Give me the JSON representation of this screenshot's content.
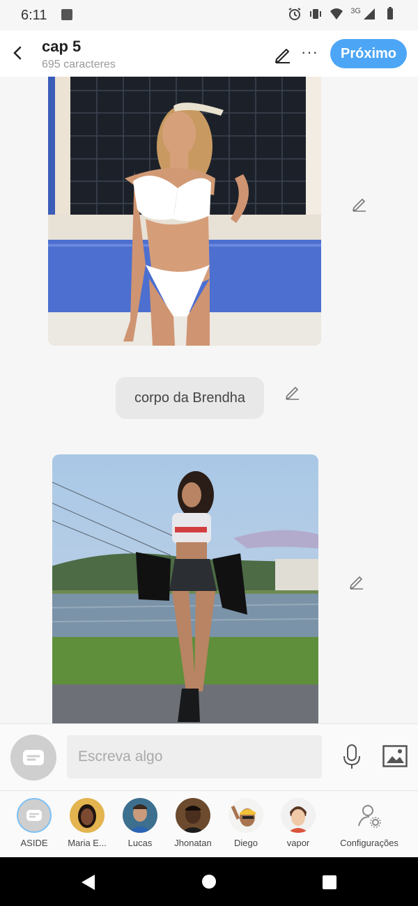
{
  "status_bar": {
    "time": "6:11",
    "network": "3G",
    "icons": [
      "image-icon",
      "alarm-icon",
      "vibrate-icon",
      "wifi-icon",
      "signal-icon",
      "battery-icon"
    ]
  },
  "header": {
    "title": "cap 5",
    "subtitle": "695 caracteres",
    "next_label": "Próximo",
    "more_label": "···",
    "accent": "#4da6f5"
  },
  "messages": [
    {
      "type": "image",
      "description_icon": "photo-1"
    },
    {
      "type": "text",
      "text": "corpo da Brendha"
    },
    {
      "type": "image",
      "description_icon": "photo-2"
    }
  ],
  "composer": {
    "placeholder": "Escreva algo"
  },
  "characters": [
    {
      "name": "ASIDE",
      "selected": true
    },
    {
      "name": "Maria E..."
    },
    {
      "name": "Lucas"
    },
    {
      "name": "Jhonatan"
    },
    {
      "name": "Diego"
    },
    {
      "name": "vapor"
    },
    {
      "name": "Configurações"
    }
  ]
}
